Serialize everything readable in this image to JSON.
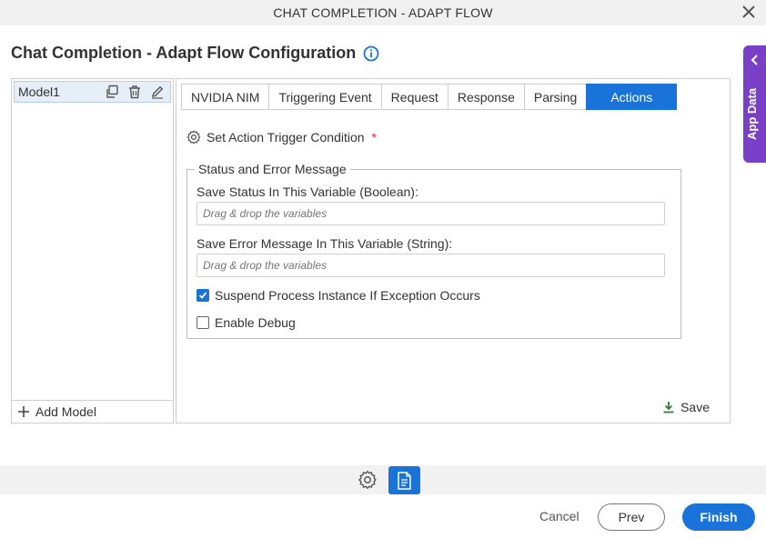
{
  "window": {
    "title": "CHAT COMPLETION - ADAPT FLOW"
  },
  "header": {
    "title": "Chat Completion - Adapt Flow Configuration"
  },
  "app_data": {
    "label": "App Data"
  },
  "models": {
    "items": [
      {
        "name": "Model1"
      }
    ],
    "add_label": "Add Model"
  },
  "tabs": [
    {
      "label": "NVIDIA NIM",
      "active": false
    },
    {
      "label": "Triggering Event",
      "active": false
    },
    {
      "label": "Request",
      "active": false
    },
    {
      "label": "Response",
      "active": false
    },
    {
      "label": "Parsing",
      "active": false
    },
    {
      "label": "Actions",
      "active": true
    }
  ],
  "actions": {
    "trigger_label": "Set Action Trigger Condition",
    "required_marker": "*",
    "group_title": "Status and Error Message",
    "status_label": "Save Status In This Variable (Boolean):",
    "status_placeholder": "Drag & drop the variables",
    "error_label": "Save Error Message In This Variable (String):",
    "error_placeholder": "Drag & drop the variables",
    "suspend_label": "Suspend Process Instance If Exception Occurs",
    "suspend_checked": true,
    "debug_label": "Enable Debug",
    "debug_checked": false,
    "save_label": "Save"
  },
  "footer": {
    "cancel": "Cancel",
    "prev": "Prev",
    "finish": "Finish"
  },
  "colors": {
    "accent": "#1a73d9",
    "app_data": "#7a3fc7",
    "required": "#d32f2f",
    "save_icon": "#2e7d32"
  },
  "icons": {
    "close": "close-icon",
    "info": "info-icon",
    "duplicate": "duplicate-icon",
    "delete": "trash-icon",
    "edit": "pencil-icon",
    "add": "plus-icon",
    "gear": "gear-icon",
    "save": "download-icon",
    "chevron": "chevron-left-icon",
    "doc": "document-icon"
  }
}
